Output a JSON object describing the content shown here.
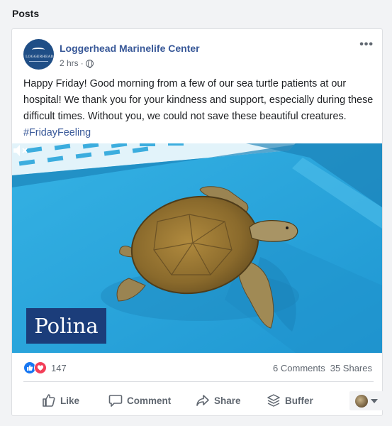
{
  "section": {
    "title": "Posts"
  },
  "post": {
    "page_name": "Loggerhead Marinelife Center",
    "avatar_text": "LOGGERHEAD",
    "time": "2 hrs",
    "separator": "·",
    "privacy_icon": "globe-icon",
    "more_label": "•••",
    "text_main": "Happy Friday! Good morning from a few of our sea turtle patients at our hospital! We thank you for your kindness and support, especially during these difficult times. Without you, we could not save these beautiful creatures. ",
    "hashtag": "#FridayFeeling",
    "media": {
      "watermark": "Polina",
      "volume_icon": "volume-muted-icon"
    },
    "reactions": {
      "icons": [
        "like-reaction-icon",
        "love-reaction-icon"
      ],
      "count": "147"
    },
    "comments": "6 Comments",
    "shares": "35 Shares",
    "actions": {
      "like": "Like",
      "comment": "Comment",
      "share": "Share",
      "buffer": "Buffer"
    }
  },
  "colors": {
    "link": "#385898",
    "water": "#2ba6dc",
    "like": "#1877f2",
    "love": "#f33e58"
  }
}
